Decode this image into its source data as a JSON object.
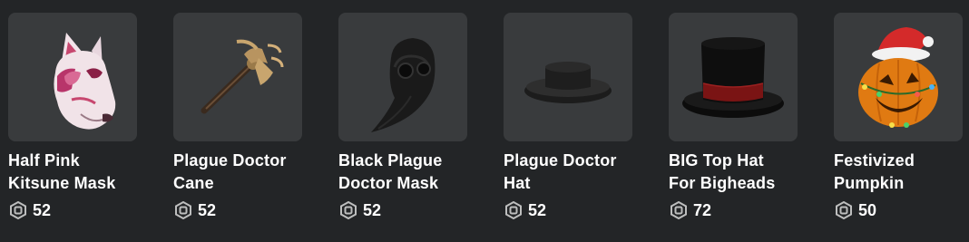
{
  "items": [
    {
      "name": "Half Pink Kitsune Mask",
      "name_line1": "Half Pink",
      "name_line2": "Kitsune Mask",
      "price": "52",
      "icon": "kitsune-mask-icon"
    },
    {
      "name": "Plague Doctor Cane",
      "name_line1": "Plague Doctor",
      "name_line2": "Cane",
      "price": "52",
      "icon": "cane-icon"
    },
    {
      "name": "Black Plague Doctor Mask",
      "name_line1": "Black Plague",
      "name_line2": "Doctor Mask",
      "price": "52",
      "icon": "plague-mask-icon"
    },
    {
      "name": "Plague Doctor Hat",
      "name_line1": "Plague Doctor",
      "name_line2": "Hat",
      "price": "52",
      "icon": "hat-icon"
    },
    {
      "name": "BIG Top Hat For Bigheads",
      "name_line1": "BIG Top Hat",
      "name_line2": "For Bigheads",
      "price": "72",
      "icon": "top-hat-icon"
    },
    {
      "name": "Festivized Pumpkin",
      "name_line1": "Festivized",
      "name_line2": "Pumpkin",
      "price": "50",
      "icon": "pumpkin-icon"
    }
  ],
  "currency_icon": "robux-icon",
  "colors": {
    "background": "#232527",
    "card": "#393b3d",
    "text": "#ffffff"
  }
}
